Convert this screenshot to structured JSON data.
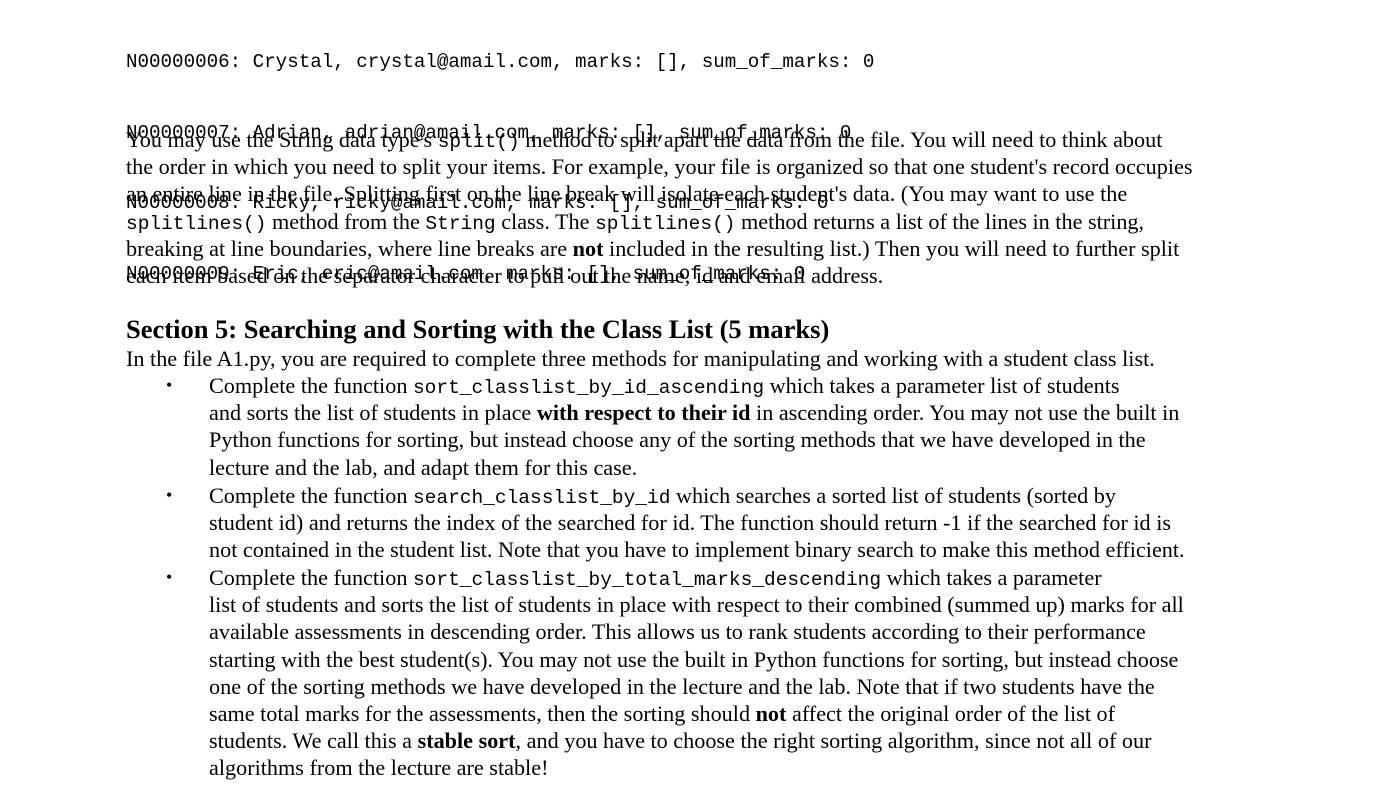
{
  "code_listing": [
    "N00000006: Crystal, crystal@amail.com, marks: [], sum_of_marks: 0",
    "N00000007: Adrian, adrian@amail.com, marks: [], sum_of_marks: 0",
    "N00000008: Ricky, ricky@amail.com, marks: [], sum_of_marks: 0",
    "N00000009: Eric, eric@amail.com, marks: [], sum_of_marks: 0"
  ],
  "paragraph": {
    "l1_a": "You may use the String data type's ",
    "l1_code": "split()",
    "l1_b": " method to split apart the data from the file. You will need to think about",
    "l2": "the order in which you need to split your items. For example, your file is organized so that one student's record occupies",
    "l3": "an entire line in the file. Splitting first on the line break will isolate each student's data. (You may want to use the",
    "l4_code1": "splitlines()",
    "l4_a": " method from the ",
    "l4_code2": "String",
    "l4_b": " class. The ",
    "l4_code3": "splitlines()",
    "l4_c": " method returns a list of the lines in the string,",
    "l5_a": "breaking at line boundaries, where line breaks are ",
    "l5_bold": "not",
    "l5_b": " included in the resulting list.) Then you will need to further split",
    "l6": "each item based on the separator character to pull out the name, id and email address."
  },
  "section": {
    "heading": "Section 5: Searching and Sorting with the Class List (5 marks)",
    "intro": "In the file A1.py, you are required to complete three methods for manipulating and working with a student class list.",
    "bullet_char": "•",
    "bullets": [
      {
        "l1_a": "Complete the function ",
        "l1_code": "sort_classlist_by_id_ascending",
        "l1_b": " which takes a parameter list of students",
        "l2_a": "and sorts the list of students in place ",
        "l2_bold": "with respect to their id",
        "l2_b": " in ascending order. You may not use the built in",
        "l3": "Python functions for sorting, but instead choose any of the sorting methods that we have developed in the",
        "l4": "lecture and the lab, and adapt them for this case."
      },
      {
        "l1_a": "Complete the function ",
        "l1_code": "search_classlist_by_id",
        "l1_b": " which searches a sorted list of students (sorted by",
        "l2": "student id) and returns the index of the searched for id. The function should return -1 if the searched for id is",
        "l3": "not contained in the student list. Note that you have to implement binary search to make this method efficient."
      },
      {
        "l1_a": "Complete the function ",
        "l1_code": "sort_classlist_by_total_marks_descending",
        "l1_b": " which takes a parameter",
        "l2": "list of students and sorts the list of students in place with respect to their combined (summed up) marks for all",
        "l3": "available assessments in descending order. This allows us to rank students according to their performance",
        "l4": "starting with the best student(s). You may not use the built in Python functions for sorting, but instead choose",
        "l5": "one of the sorting methods we have developed in the lecture and the lab. Note that if two students have the",
        "l6_a": "same total marks for the assessments, then the sorting should ",
        "l6_bold": "not",
        "l6_b": " affect the original order of the list of",
        "l7_a": "students. We call this a ",
        "l7_bold": "stable sort",
        "l7_b": ", and you have to choose the right sorting algorithm, since not all of our",
        "l8": "algorithms from the lecture are stable!"
      }
    ]
  }
}
